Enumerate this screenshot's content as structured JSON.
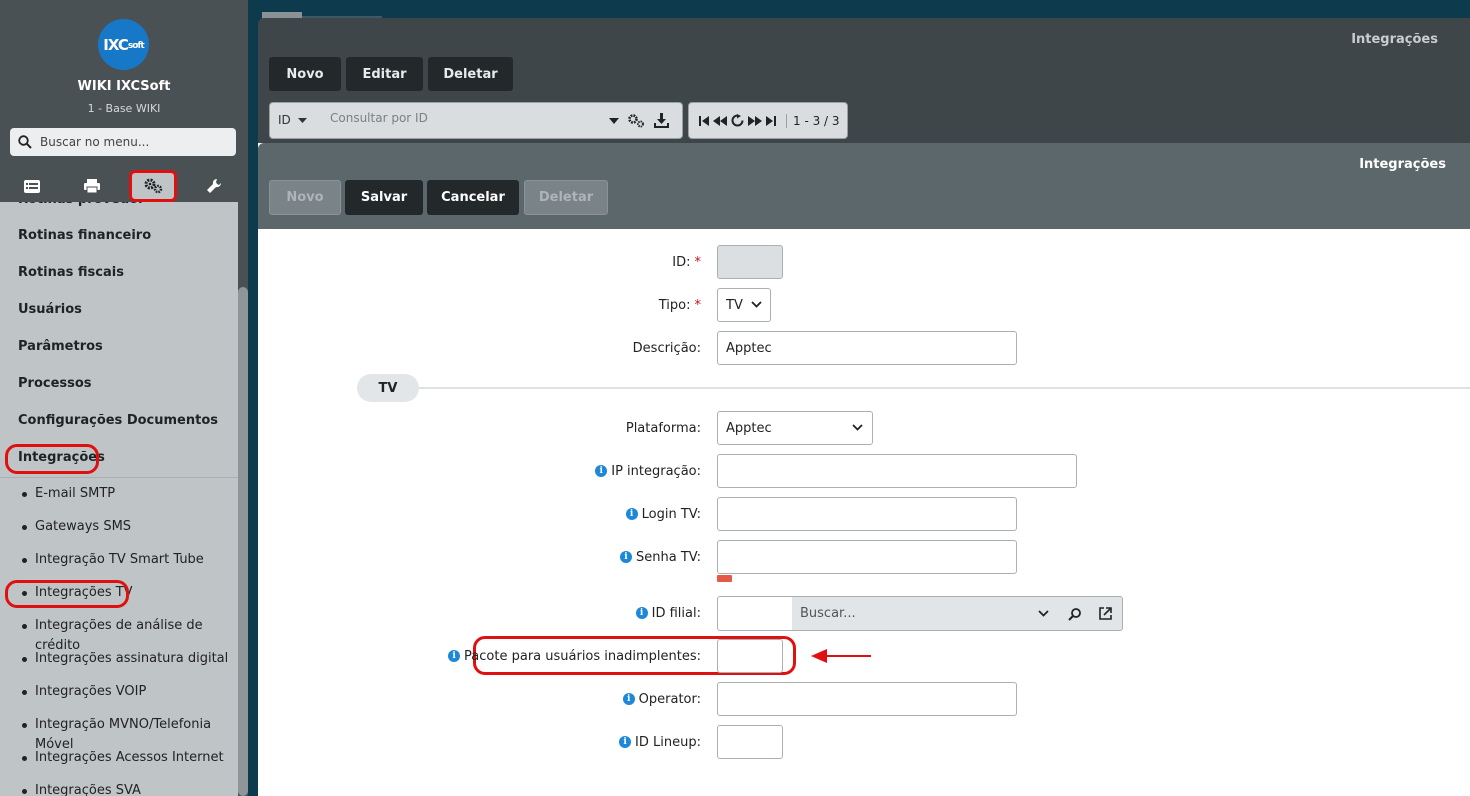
{
  "sidebar": {
    "logo_text": "IXC",
    "logo_small": "soft",
    "app_name": "WIKI IXCSoft",
    "app_sub": "1 - Base WIKI",
    "search_placeholder": "Buscar no menu...",
    "tabs": [
      "list-icon",
      "print-icon",
      "gears-icon",
      "wrench-icon"
    ],
    "menu_items": [
      "Rotinas provedor",
      "Rotinas financeiro",
      "Rotinas fiscais",
      "Usuários",
      "Parâmetros",
      "Processos",
      "Configurações Documentos",
      "Integrações"
    ],
    "sub_items": [
      "E-mail SMTP",
      "Gateways SMS",
      "Integração TV Smart Tube",
      "Integrações TV",
      "Integrações de análise de crédito",
      "Integrações assinatura digital",
      "Integrações VOIP",
      "Integração MVNO/Telefonia Móvel",
      "Integrações Acessos Internet",
      "Integrações SVA"
    ]
  },
  "list": {
    "title": "Integrações",
    "buttons": [
      "Novo",
      "Editar",
      "Deletar"
    ],
    "search_field": "ID",
    "search_placeholder": "Consultar por ID",
    "pager_count": "1 - 3 / 3"
  },
  "form": {
    "title": "Integrações",
    "buttons": [
      "Novo",
      "Salvar",
      "Cancelar",
      "Deletar"
    ],
    "labels": {
      "id": "ID:",
      "tipo": "Tipo:",
      "descricao": "Descrição:",
      "plataforma": "Plataforma:",
      "ip": "IP integração:",
      "login": "Login TV:",
      "senha": "Senha TV:",
      "filial": "ID filial:",
      "pacote": "Pacote para usuários inadimplentes:",
      "operator": "Operator:",
      "lineup": "ID Lineup:"
    },
    "values": {
      "id": "",
      "tipo": "TV",
      "descricao": "Apptec",
      "plataforma": "Apptec",
      "ip": "",
      "login": "",
      "senha": "",
      "filial": "",
      "pacote": "",
      "operator": "",
      "lineup": ""
    },
    "section": "TV",
    "filial_placeholder": "Buscar...",
    "required_mark": "*",
    "info_glyph": "i"
  },
  "colors": {
    "highlight": "#e01010",
    "info": "#1d87d8",
    "sidebar": "#4a5154",
    "menu": "#bfc4c6"
  }
}
